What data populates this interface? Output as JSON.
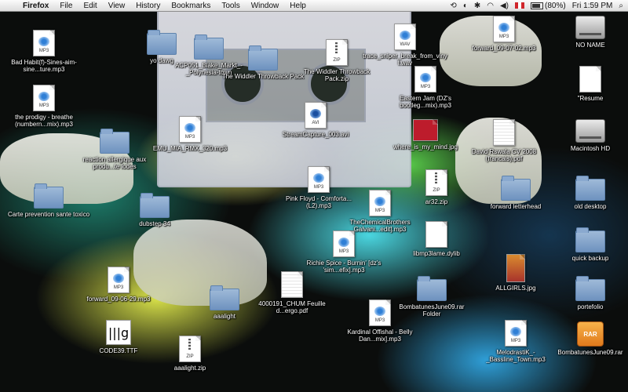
{
  "menubar": {
    "apple_glyph": "",
    "app_name": "Firefox",
    "menus": [
      "File",
      "Edit",
      "View",
      "History",
      "Bookmarks",
      "Tools",
      "Window",
      "Help"
    ],
    "battery": "(80%)",
    "clock": "Fri 1:59 PM"
  },
  "desktop": {
    "icons": [
      {
        "label": "Bad Habit(f)-Sines-aim-sine...ture.mp3",
        "kind": "mp3",
        "tag": "MP3"
      },
      {
        "label": "the prodigy - breathe (numbern...mix).mp3",
        "kind": "mp3",
        "tag": "MP3"
      },
      {
        "label": "reaction allergique aux produ...te lodes",
        "kind": "folder",
        "tag": ""
      },
      {
        "label": "Carte prevention sante toxico",
        "kind": "folder",
        "tag": ""
      },
      {
        "label": "dubstep 34",
        "kind": "folder",
        "tag": ""
      },
      {
        "label": "yo dawg",
        "kind": "folder",
        "tag": ""
      },
      {
        "label": "ACP051_Blake_Markt_-_Polynesia-town",
        "kind": "folder",
        "tag": ""
      },
      {
        "label": "The Widdler Throwback Pack",
        "kind": "folder",
        "tag": ""
      },
      {
        "label": "The Widdler Throwback Pack.zip",
        "kind": "zip",
        "tag": "ZIP"
      },
      {
        "label": "trace_sniper_break_from_vinyl.wav",
        "kind": "mp3",
        "tag": "WAV"
      },
      {
        "label": "forward_09-07-02.mp3",
        "kind": "mp3",
        "tag": "MP3"
      },
      {
        "label": "NO NAME",
        "kind": "disk",
        "tag": ""
      },
      {
        "label": "Eastern Jam (DZ's bootleg...mix).mp3",
        "kind": "mp3",
        "tag": "MP3"
      },
      {
        "label": "\"Resume",
        "kind": "plain",
        "tag": ""
      },
      {
        "label": "EMU_MIA_RMX_320.mp3",
        "kind": "mp3",
        "tag": "MP3"
      },
      {
        "label": "StreamCapture_003.avi",
        "kind": "avi",
        "tag": "AVI"
      },
      {
        "label": "where_is_my_mind.jpg",
        "kind": "img",
        "tag": ""
      },
      {
        "label": "David Rswala CV 2008 (francais).pdf",
        "kind": "pdf",
        "tag": ""
      },
      {
        "label": "Macintosh HD",
        "kind": "disk",
        "tag": ""
      },
      {
        "label": "Pink Floyd - Comforta... (L2).mp3",
        "kind": "mp3",
        "tag": "MP3"
      },
      {
        "label": "TheChemicalBrothers Galvani...edit].mp3",
        "kind": "mp3",
        "tag": "MP3"
      },
      {
        "label": "ar32.zip",
        "kind": "zip",
        "tag": "ZIP"
      },
      {
        "label": "forward letterhead",
        "kind": "folder",
        "tag": ""
      },
      {
        "label": "old desktop",
        "kind": "folder",
        "tag": ""
      },
      {
        "label": "libmp3lame.dylib",
        "kind": "plain",
        "tag": ""
      },
      {
        "label": "quick backup",
        "kind": "folder",
        "tag": ""
      },
      {
        "label": "Richie Spice - Burnin' [dz's 'sim...efix].mp3",
        "kind": "mp3",
        "tag": "MP3"
      },
      {
        "label": "forward_09-06-29.mp3",
        "kind": "mp3",
        "tag": "MP3"
      },
      {
        "label": "aaalight",
        "kind": "folder",
        "tag": ""
      },
      {
        "label": "4000191_CHUM Feuille d...ergo.pdf",
        "kind": "pdf",
        "tag": ""
      },
      {
        "label": "BombatunesJune09.rar Folder",
        "kind": "folder",
        "tag": ""
      },
      {
        "label": "ALLGIRLS.jpg",
        "kind": "img2",
        "tag": ""
      },
      {
        "label": "portefolio",
        "kind": "folder",
        "tag": ""
      },
      {
        "label": "CODE39.TTF",
        "kind": "ttf",
        "tag": "|||g"
      },
      {
        "label": "aaalight.zip",
        "kind": "zip",
        "tag": "ZIP"
      },
      {
        "label": "Kardinal Offishal - Belly Dan...mix].mp3",
        "kind": "mp3",
        "tag": "MP3"
      },
      {
        "label": "MelodrastiK_-_Bassline_Town.mp3",
        "kind": "mp3",
        "tag": "MP3"
      },
      {
        "label": "BombatunesJune09.rar",
        "kind": "rar",
        "tag": "RAR"
      }
    ]
  }
}
